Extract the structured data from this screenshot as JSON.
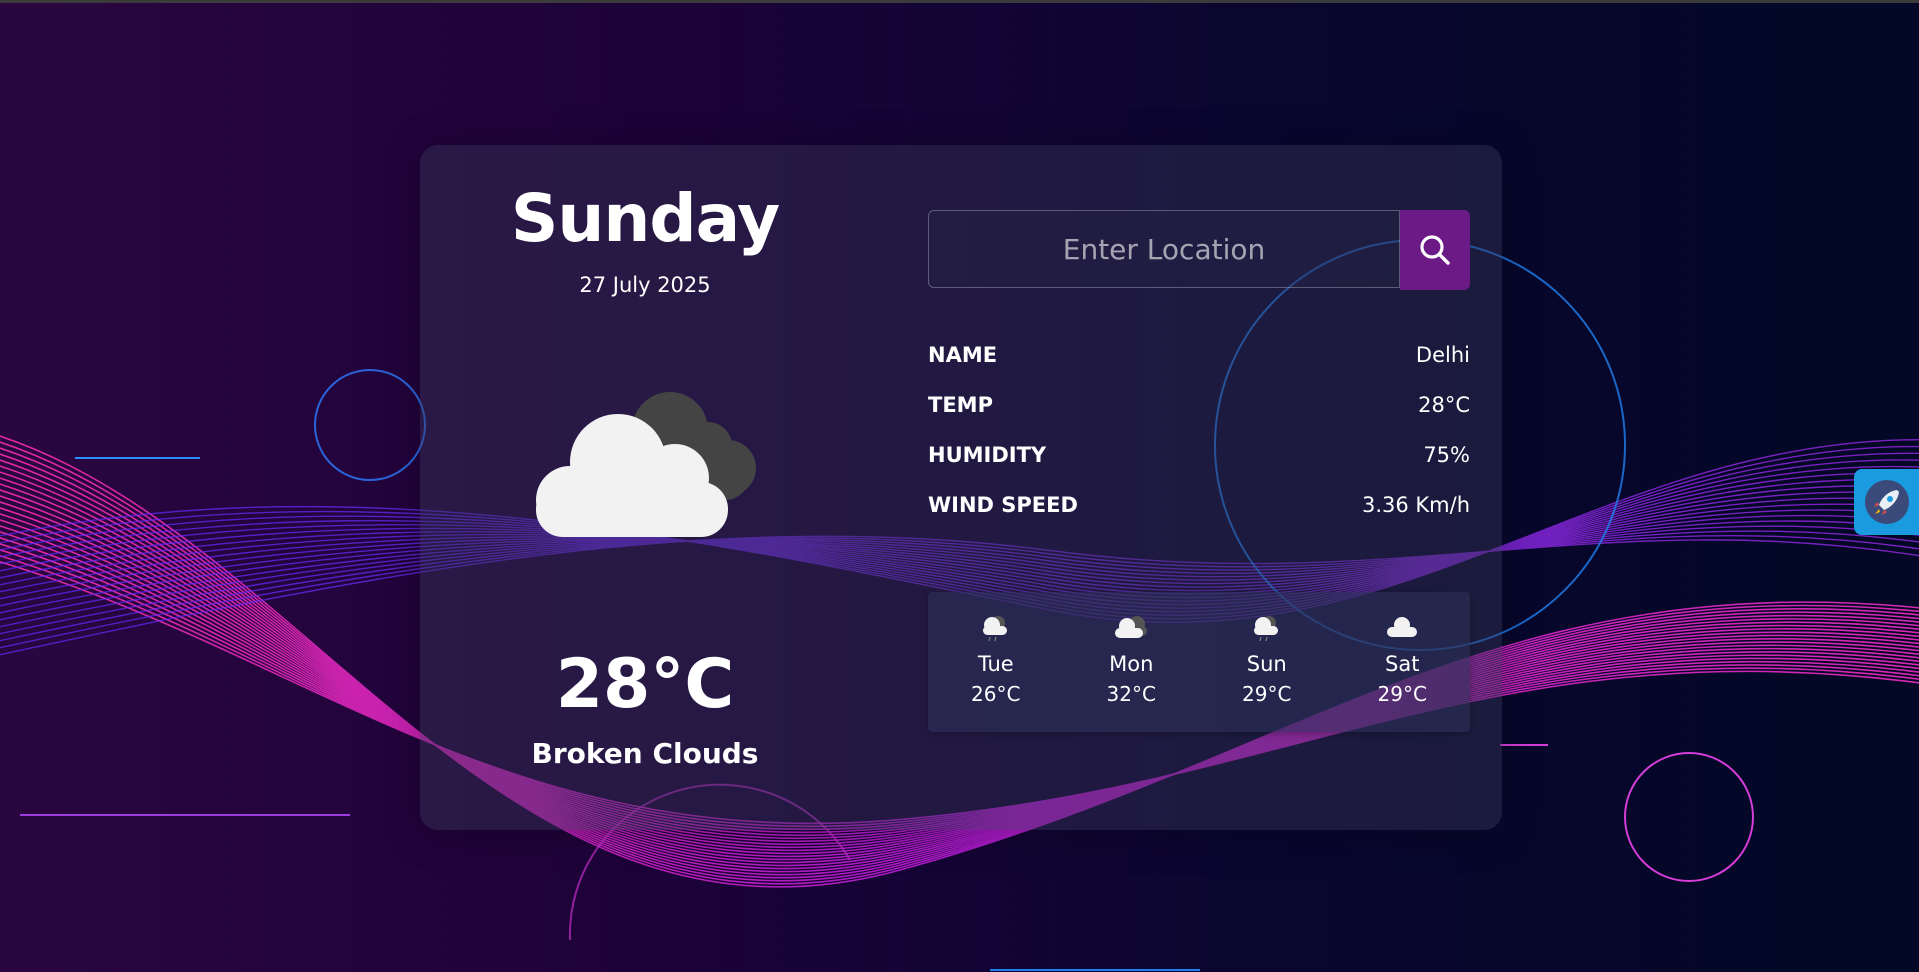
{
  "weather": {
    "day": "Sunday",
    "date": "27 July 2025",
    "icon": "broken-clouds-icon",
    "temperature": "28°C",
    "description": "Broken Clouds"
  },
  "search": {
    "placeholder": "Enter Location",
    "value": ""
  },
  "details": [
    {
      "label": "NAME",
      "value": "Delhi"
    },
    {
      "label": "TEMP",
      "value": "28°C"
    },
    {
      "label": "HUMIDITY",
      "value": "75%"
    },
    {
      "label": "WIND SPEED",
      "value": "3.36 Km/h"
    }
  ],
  "forecast": [
    {
      "day": "Tue",
      "temp": "26°C",
      "icon": "light-rain-icon"
    },
    {
      "day": "Mon",
      "temp": "32°C",
      "icon": "broken-clouds-icon"
    },
    {
      "day": "Sun",
      "temp": "29°C",
      "icon": "light-rain-icon"
    },
    {
      "day": "Sat",
      "temp": "29°C",
      "icon": "cloud-icon"
    }
  ],
  "colors": {
    "accent": "#6c1b86",
    "floating_button": "#1a9be0"
  }
}
